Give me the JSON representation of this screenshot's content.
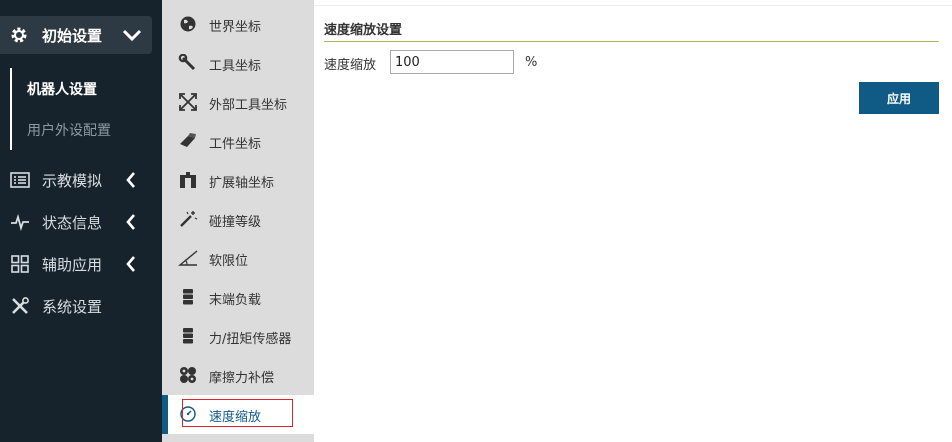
{
  "sidebar": {
    "top_item": {
      "label": "初始设置",
      "icon": "gear-icon",
      "expanded": true
    },
    "sub_items": [
      {
        "label": "机器人设置",
        "active": true
      },
      {
        "label": "用户外设配置",
        "active": false
      }
    ],
    "items": [
      {
        "label": "示教模拟",
        "icon": "list-icon"
      },
      {
        "label": "状态信息",
        "icon": "pulse-icon"
      },
      {
        "label": "辅助应用",
        "icon": "grid-icon"
      },
      {
        "label": "系统设置",
        "icon": "tools-icon"
      }
    ]
  },
  "menu": {
    "items": [
      {
        "label": "世界坐标",
        "icon": "globe-icon"
      },
      {
        "label": "工具坐标",
        "icon": "wrench-icon"
      },
      {
        "label": "外部工具坐标",
        "icon": "expand-arrows-icon"
      },
      {
        "label": "工件坐标",
        "icon": "eraser-icon"
      },
      {
        "label": "扩展轴坐标",
        "icon": "axis-icon"
      },
      {
        "label": "碰撞等级",
        "icon": "magic-wand-icon"
      },
      {
        "label": "软限位",
        "icon": "angle-icon"
      },
      {
        "label": "末端负载",
        "icon": "server-icon"
      },
      {
        "label": "力/扭矩传感器",
        "icon": "server-icon"
      },
      {
        "label": "摩擦力补偿",
        "icon": "cogs-icon"
      },
      {
        "label": "速度缩放",
        "icon": "dashboard-icon",
        "active": true
      }
    ]
  },
  "panel": {
    "title": "速度缩放设置",
    "speed_label": "速度缩放",
    "speed_value": "100",
    "unit": "%",
    "apply_label": "应用"
  },
  "colors": {
    "sidebar_bg": "#16232c",
    "menu_bg": "#dcdcdc",
    "accent": "#0f5b86",
    "highlight_border": "#d9262a"
  }
}
